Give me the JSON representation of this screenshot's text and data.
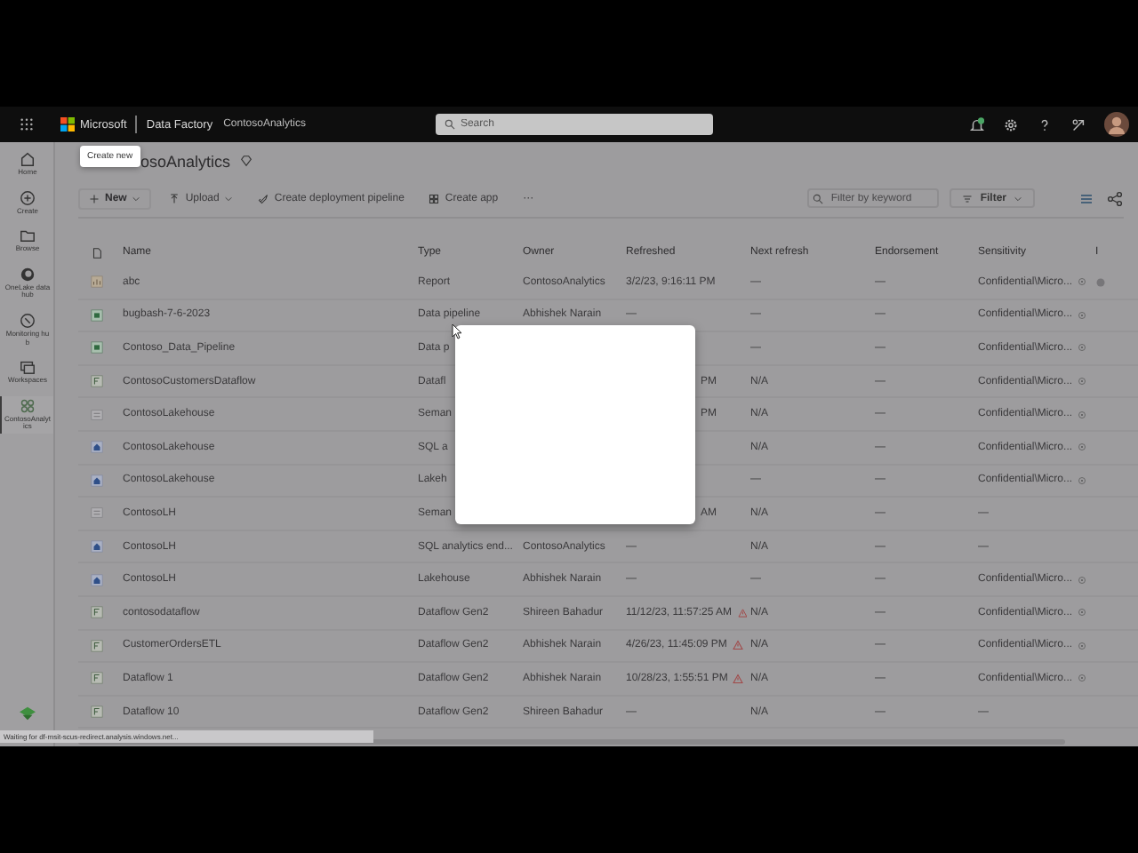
{
  "top_bar": {
    "brand": "Microsoft",
    "app": "Data Factory",
    "workspace": "ContosoAnalytics",
    "search": {
      "placeholder": "Search"
    }
  },
  "nav": [
    {
      "label": "Home",
      "kind": "home",
      "selected": false
    },
    {
      "label": "Create",
      "kind": "create",
      "selected": false
    },
    {
      "label": "Browse",
      "kind": "browse",
      "selected": false
    },
    {
      "label": "OneLake data hub",
      "kind": "hub",
      "selected": false
    },
    {
      "label": "Monitoring hub",
      "kind": "monitor",
      "selected": false
    },
    {
      "label": "Workspaces",
      "kind": "workspaces",
      "selected": false
    },
    {
      "label": "ContosoAnalytics",
      "kind": "workspace",
      "selected": true
    }
  ],
  "tooltip": "Create new",
  "title": "osoAnalytics",
  "toolbar": [
    {
      "label": "New",
      "kind": "new"
    },
    {
      "label": "Upload",
      "kind": "upload"
    },
    {
      "label": "Create deployment pipeline",
      "kind": "pipeline"
    },
    {
      "label": "Create app",
      "kind": "app"
    },
    {
      "label": "···",
      "kind": "more"
    }
  ],
  "filter": {
    "placeholder": "Filter by keyword",
    "button": "Filter"
  },
  "table": {
    "columns": [
      "Name",
      "Type",
      "Owner",
      "Refreshed",
      "Next refresh",
      "Endorsement",
      "Sensitivity",
      "I"
    ],
    "rows": [
      {
        "kind": "report",
        "name": "abc",
        "type": "Report",
        "owner": "ContosoAnalytics",
        "refreshed": "3/2/23, 9:16:11 PM",
        "clipped": false,
        "warning": false,
        "next_refresh": "—",
        "endorsement": "—",
        "sensitivity": "Confidential\\Micro...",
        "shield": true,
        "marked": true
      },
      {
        "kind": "pipeline",
        "name": "bugbash-7-6-2023",
        "type": "Data pipeline",
        "owner": "Abhishek Narain",
        "refreshed": "—",
        "clipped": false,
        "warning": false,
        "next_refresh": "—",
        "endorsement": "—",
        "sensitivity": "Confidential\\Micro...",
        "shield": true,
        "marked": false
      },
      {
        "kind": "pipeline",
        "name": "Contoso_Data_Pipeline",
        "type": "Data p",
        "warning": false,
        "next_refresh": "—",
        "endorsement": "—",
        "sensitivity": "Confidential\\Micro...",
        "shield": true,
        "marked": false
      },
      {
        "kind": "dataflow",
        "name": "ContosoCustomersDataflow",
        "type": "Datafl",
        "refreshed": "PM",
        "clipped": true,
        "warning": false,
        "next_refresh": "N/A",
        "endorsement": "—",
        "sensitivity": "Confidential\\Micro...",
        "shield": true,
        "marked": false
      },
      {
        "kind": "semantic",
        "name": "ContosoLakehouse",
        "type": "Seman",
        "refreshed": "PM",
        "clipped": true,
        "warning": false,
        "next_refresh": "N/A",
        "endorsement": "—",
        "sensitivity": "Confidential\\Micro...",
        "shield": true,
        "marked": false
      },
      {
        "kind": "lakehouse",
        "name": "ContosoLakehouse",
        "type": "SQL a",
        "warning": false,
        "next_refresh": "N/A",
        "endorsement": "—",
        "sensitivity": "Confidential\\Micro...",
        "shield": true,
        "marked": false
      },
      {
        "kind": "lakehouse",
        "name": "ContosoLakehouse",
        "type": "Lakeh",
        "warning": false,
        "next_refresh": "—",
        "endorsement": "—",
        "sensitivity": "Confidential\\Micro...",
        "shield": true,
        "marked": false
      },
      {
        "kind": "semantic",
        "name": "ContosoLH",
        "type": "Seman",
        "refreshed": "AM",
        "clipped": true,
        "warning": false,
        "next_refresh": "N/A",
        "endorsement": "—",
        "sensitivity": "—",
        "shield": false,
        "marked": false
      },
      {
        "kind": "lakehouse",
        "name": "ContosoLH",
        "type": "SQL analytics end...",
        "owner": "ContosoAnalytics",
        "refreshed": "—",
        "clipped": false,
        "warning": false,
        "next_refresh": "N/A",
        "endorsement": "—",
        "sensitivity": "—",
        "shield": false,
        "marked": false
      },
      {
        "kind": "lakehouse",
        "name": "ContosoLH",
        "type": "Lakehouse",
        "owner": "Abhishek Narain",
        "refreshed": "—",
        "clipped": false,
        "warning": false,
        "next_refresh": "—",
        "endorsement": "—",
        "sensitivity": "Confidential\\Micro...",
        "shield": true,
        "marked": false
      },
      {
        "kind": "dataflow",
        "name": "contosodataflow",
        "type": "Dataflow Gen2",
        "owner": "Shireen Bahadur",
        "refreshed": "11/12/23, 11:57:25 AM",
        "clipped": false,
        "warning": true,
        "next_refresh": "N/A",
        "endorsement": "—",
        "sensitivity": "Confidential\\Micro...",
        "shield": true,
        "marked": false
      },
      {
        "kind": "dataflow",
        "name": "CustomerOrdersETL",
        "type": "Dataflow Gen2",
        "owner": "Abhishek Narain",
        "refreshed": "4/26/23, 11:45:09 PM",
        "clipped": false,
        "warning": true,
        "next_refresh": "N/A",
        "endorsement": "—",
        "sensitivity": "Confidential\\Micro...",
        "shield": true,
        "marked": false
      },
      {
        "kind": "dataflow",
        "name": "Dataflow 1",
        "type": "Dataflow Gen2",
        "owner": "Abhishek Narain",
        "refreshed": "10/28/23, 1:55:51 PM",
        "clipped": false,
        "warning": true,
        "next_refresh": "N/A",
        "endorsement": "—",
        "sensitivity": "Confidential\\Micro...",
        "shield": true,
        "marked": false
      },
      {
        "kind": "dataflow",
        "name": "Dataflow 10",
        "type": "Dataflow Gen2",
        "owner": "Shireen Bahadur",
        "refreshed": "—",
        "clipped": false,
        "warning": false,
        "next_refresh": "N/A",
        "endorsement": "—",
        "sensitivity": "—",
        "shield": false,
        "marked": false
      }
    ]
  },
  "status_bar": "Waiting for df-msit-scus-redirect.analysis.windows.net..."
}
